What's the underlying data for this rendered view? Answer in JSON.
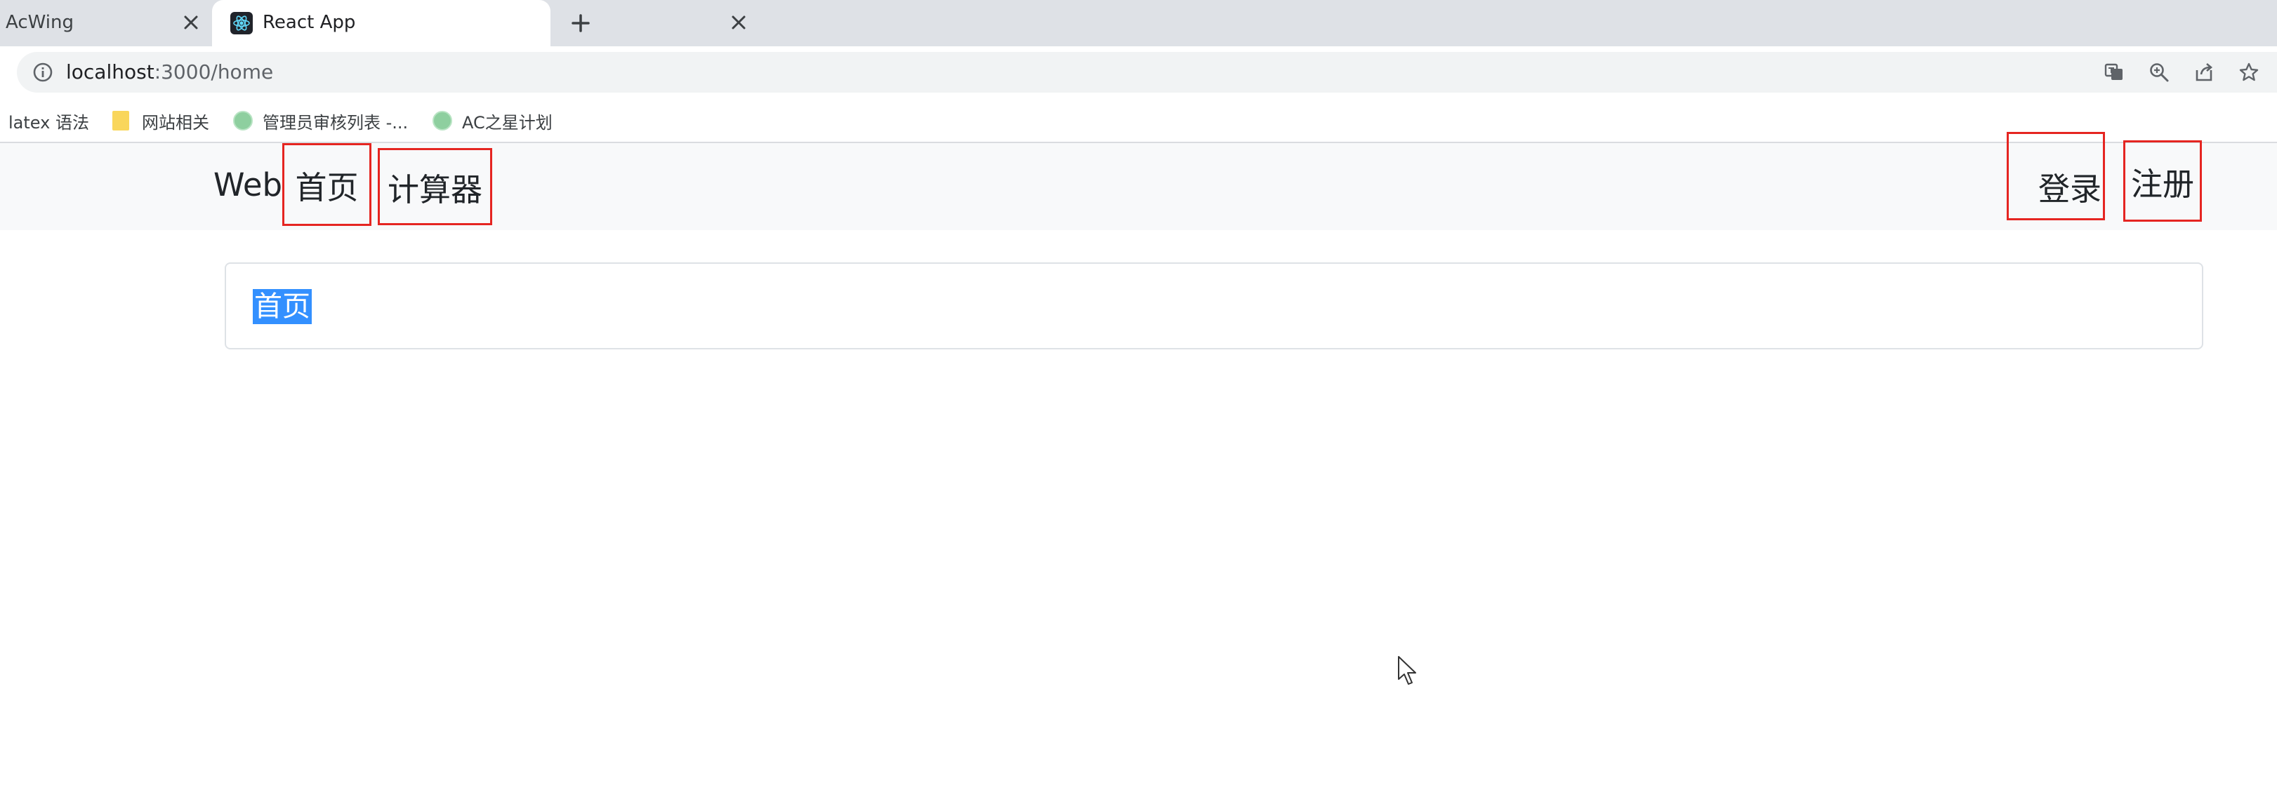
{
  "browser": {
    "tabs": [
      {
        "title": "AcWing",
        "active": false
      },
      {
        "title": "React App",
        "active": true
      }
    ],
    "address": {
      "host": "localhost",
      "path": ":3000/home"
    },
    "bookmarks": [
      {
        "label": "latex 语法",
        "icon": "none"
      },
      {
        "label": "网站相关",
        "icon": "folder-icon"
      },
      {
        "label": "管理员审核列表 -...",
        "icon": "globe-icon"
      },
      {
        "label": "AC之星计划",
        "icon": "globe-icon"
      }
    ],
    "toolbar_icons": [
      "translate-icon",
      "zoom-icon",
      "share-icon",
      "bookmark-star-icon"
    ]
  },
  "navbar": {
    "brand": "Web",
    "links": {
      "home": "首页",
      "calculator": "计算器",
      "login": "登录",
      "register": "注册"
    }
  },
  "content": {
    "card_text": "首页"
  },
  "colors": {
    "highlight_box": "#e52521",
    "selection": "#3390ff",
    "navbar_bg": "#f8f9fa",
    "tabstrip_bg": "#dee1e6"
  }
}
